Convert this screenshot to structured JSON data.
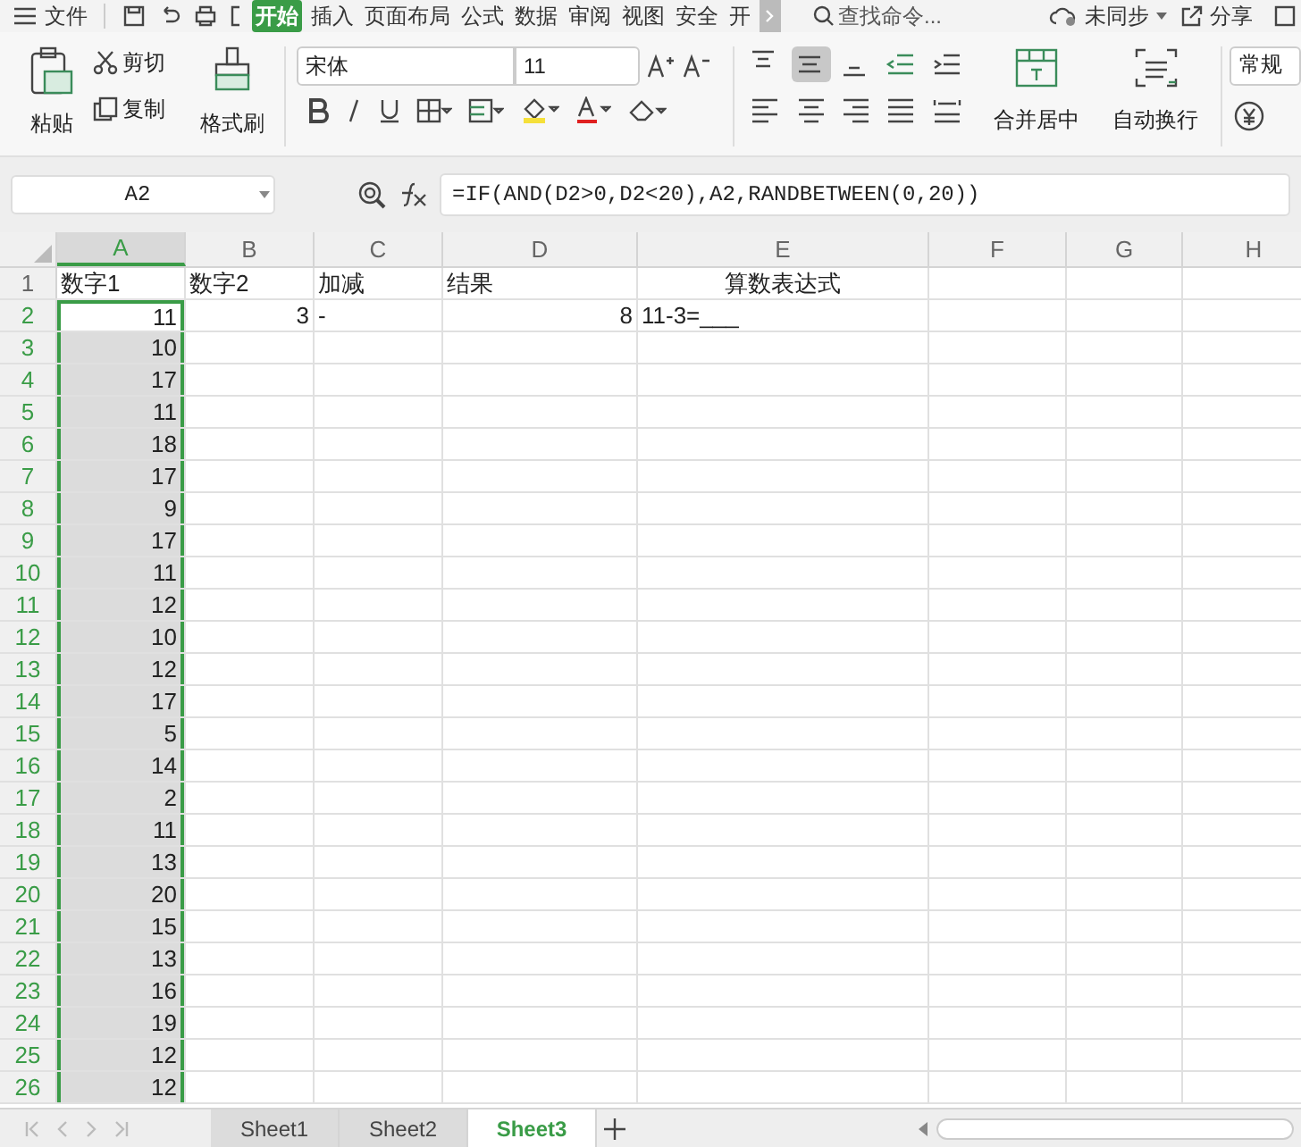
{
  "menu_bar": [
    {
      "label": "文件",
      "selected": false
    },
    {
      "label": "开始",
      "selected": true
    },
    {
      "label": "插入",
      "selected": false
    },
    {
      "label": "页面布局",
      "selected": false
    },
    {
      "label": "公式",
      "selected": false
    },
    {
      "label": "数据",
      "selected": false
    },
    {
      "label": "审阅",
      "selected": false
    },
    {
      "label": "视图",
      "selected": false
    },
    {
      "label": "安全",
      "selected": false
    },
    {
      "label": "开",
      "selected": false
    }
  ],
  "search": {
    "placeholder": "查找命令..."
  },
  "sync_status": "未同步",
  "share": "分享",
  "ribbon": {
    "paste": "粘贴",
    "cut": "剪切",
    "copy": "复制",
    "format_painter": "格式刷",
    "font": "宋体",
    "font_size": "11",
    "vertical_align": [
      {
        "selected": false
      },
      {
        "selected": true
      },
      {
        "selected": false
      }
    ],
    "merge": "合并居中",
    "wrap": "自动换行",
    "number_format": "常规"
  },
  "name_box": "A2",
  "formula": "=IF(AND(D2>0,D2<20),A2,RANDBETWEEN(0,20))",
  "columns": [
    {
      "label": "A",
      "selected": true
    },
    {
      "label": "B",
      "selected": false
    },
    {
      "label": "C",
      "selected": false
    },
    {
      "label": "D",
      "selected": false
    },
    {
      "label": "E",
      "selected": false
    },
    {
      "label": "F",
      "selected": false
    },
    {
      "label": "G",
      "selected": false
    },
    {
      "label": "H",
      "selected": false
    }
  ],
  "rows": [
    {
      "number": "1",
      "selected": false,
      "cells": [
        {
          "text": "数字1",
          "kind": "text"
        },
        {
          "text": "数字2",
          "kind": "text"
        },
        {
          "text": "加减",
          "kind": "text"
        },
        {
          "text": "结果",
          "kind": "text"
        },
        {
          "text": "算数表达式",
          "kind": "center"
        }
      ]
    },
    {
      "number": "2",
      "selected": true,
      "cells": [
        {
          "text": "11",
          "kind": "number",
          "active": true
        },
        {
          "text": "3",
          "kind": "number"
        },
        {
          "text": "-",
          "kind": "text"
        },
        {
          "text": "8",
          "kind": "number"
        },
        {
          "text": "11-3=___",
          "kind": "text"
        }
      ]
    },
    {
      "number": "3",
      "selected": true,
      "cells": [
        {
          "text": "10",
          "kind": "number"
        }
      ]
    },
    {
      "number": "4",
      "selected": true,
      "cells": [
        {
          "text": "17",
          "kind": "number"
        }
      ]
    },
    {
      "number": "5",
      "selected": true,
      "cells": [
        {
          "text": "11",
          "kind": "number"
        }
      ]
    },
    {
      "number": "6",
      "selected": true,
      "cells": [
        {
          "text": "18",
          "kind": "number"
        }
      ]
    },
    {
      "number": "7",
      "selected": true,
      "cells": [
        {
          "text": "17",
          "kind": "number"
        }
      ]
    },
    {
      "number": "8",
      "selected": true,
      "cells": [
        {
          "text": "9",
          "kind": "number"
        }
      ]
    },
    {
      "number": "9",
      "selected": true,
      "cells": [
        {
          "text": "17",
          "kind": "number"
        }
      ]
    },
    {
      "number": "10",
      "selected": true,
      "cells": [
        {
          "text": "11",
          "kind": "number"
        }
      ]
    },
    {
      "number": "11",
      "selected": true,
      "cells": [
        {
          "text": "12",
          "kind": "number"
        }
      ]
    },
    {
      "number": "12",
      "selected": true,
      "cells": [
        {
          "text": "10",
          "kind": "number"
        }
      ]
    },
    {
      "number": "13",
      "selected": true,
      "cells": [
        {
          "text": "12",
          "kind": "number"
        }
      ]
    },
    {
      "number": "14",
      "selected": true,
      "cells": [
        {
          "text": "17",
          "kind": "number"
        }
      ]
    },
    {
      "number": "15",
      "selected": true,
      "cells": [
        {
          "text": "5",
          "kind": "number"
        }
      ]
    },
    {
      "number": "16",
      "selected": true,
      "cells": [
        {
          "text": "14",
          "kind": "number"
        }
      ]
    },
    {
      "number": "17",
      "selected": true,
      "cells": [
        {
          "text": "2",
          "kind": "number"
        }
      ]
    },
    {
      "number": "18",
      "selected": true,
      "cells": [
        {
          "text": "11",
          "kind": "number"
        }
      ]
    },
    {
      "number": "19",
      "selected": true,
      "cells": [
        {
          "text": "13",
          "kind": "number"
        }
      ]
    },
    {
      "number": "20",
      "selected": true,
      "cells": [
        {
          "text": "20",
          "kind": "number"
        }
      ]
    },
    {
      "number": "21",
      "selected": true,
      "cells": [
        {
          "text": "15",
          "kind": "number"
        }
      ]
    },
    {
      "number": "22",
      "selected": true,
      "cells": [
        {
          "text": "13",
          "kind": "number"
        }
      ]
    },
    {
      "number": "23",
      "selected": true,
      "cells": [
        {
          "text": "16",
          "kind": "number"
        }
      ]
    },
    {
      "number": "24",
      "selected": true,
      "cells": [
        {
          "text": "19",
          "kind": "number"
        }
      ]
    },
    {
      "number": "25",
      "selected": true,
      "cells": [
        {
          "text": "12",
          "kind": "number"
        }
      ]
    },
    {
      "number": "26",
      "selected": true,
      "cells": [
        {
          "text": "12",
          "kind": "number"
        }
      ]
    }
  ],
  "sheet_tabs": [
    {
      "label": "Sheet1",
      "selected": false
    },
    {
      "label": "Sheet2",
      "selected": false
    },
    {
      "label": "Sheet3",
      "selected": true
    }
  ]
}
